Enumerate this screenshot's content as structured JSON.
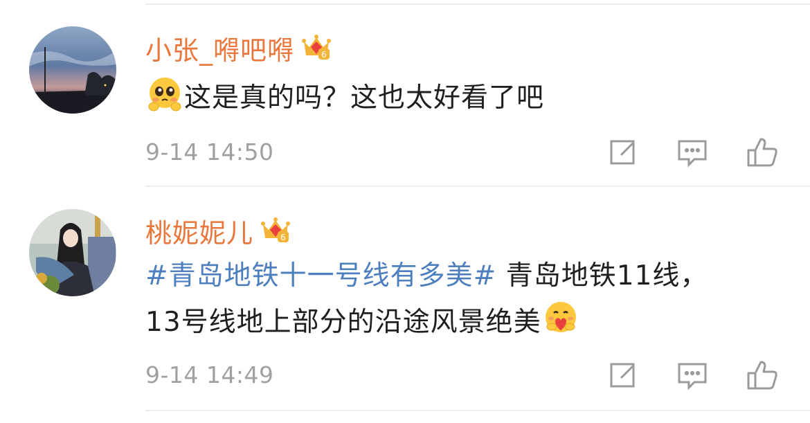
{
  "colors": {
    "name": "#e9773b",
    "hashtag": "#4d7fbe",
    "text": "#1f1f1f",
    "time": "#a0a0a0",
    "icon": "#9a9a9a"
  },
  "comments": [
    {
      "avatar": "night-sky-avatar",
      "username": "小张_嘚吧嘚",
      "badge": "crown-icon",
      "badge_level": "6",
      "emoji": "pleading-face-emoji",
      "text": "这是真的吗？这也太好看了吧",
      "time": "9-14 14:50"
    },
    {
      "avatar": "anime-girl-avatar",
      "username": "桃妮妮儿",
      "badge": "crown-icon",
      "badge_level": "6",
      "hashtag": "#青岛地铁十一号线有多美#",
      "text_line1": " 青岛地铁11线，",
      "text_line2": "13号线地上部分的沿途风景绝美",
      "emoji": "hugging-heart-emoji",
      "time": "9-14 14:49"
    }
  ],
  "actions": [
    "share-icon",
    "comment-icon",
    "like-icon"
  ]
}
